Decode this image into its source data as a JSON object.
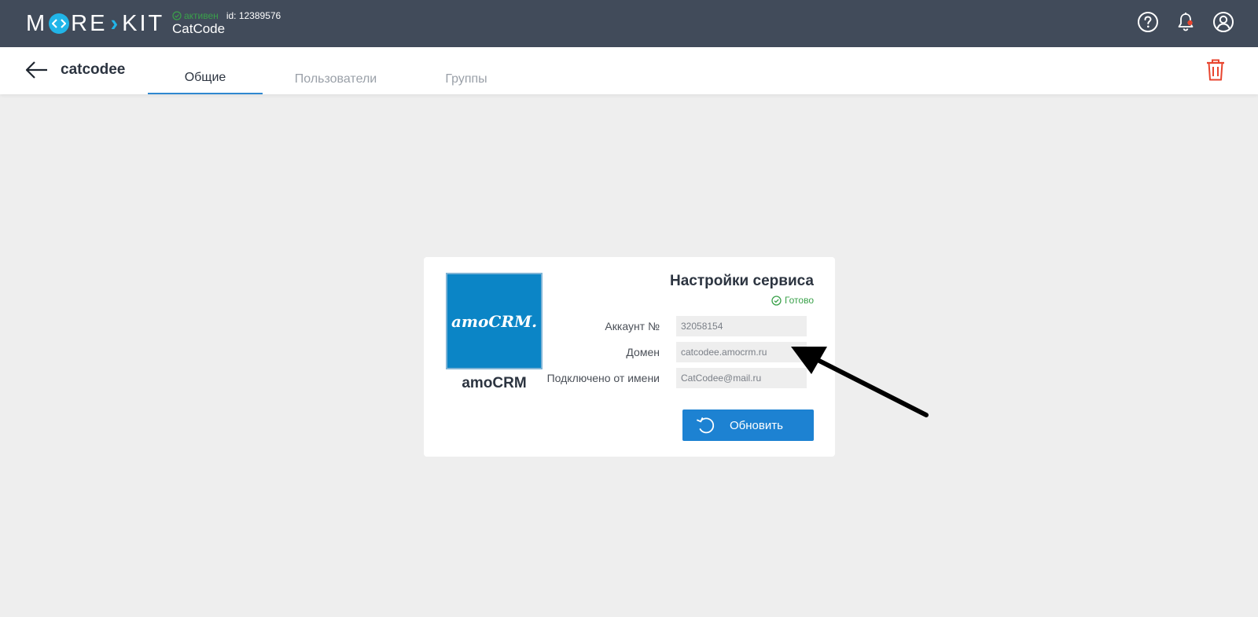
{
  "header": {
    "logo_text_left": "M",
    "logo_text_mid": "RE",
    "logo_text_right": "KIT",
    "logo_brand": "MOREKIT",
    "status_active": "активен",
    "account_id": "id: 12389576",
    "company_name": "CatCode",
    "icons": [
      "help-icon",
      "bell-icon",
      "user-profile-icon"
    ],
    "bell_notification_color": "#e8452f"
  },
  "subheader": {
    "title": "catcodee",
    "tabs": [
      {
        "label": "Общие",
        "active": true
      },
      {
        "label": "Пользователи",
        "active": false
      },
      {
        "label": "Группы",
        "active": false
      }
    ],
    "delete_icon_color": "#e8452f"
  },
  "service": {
    "logo_text": "amoCRM.",
    "name": "amoCRM",
    "settings_title": "Настройки сервиса",
    "status": "Готово",
    "fields": [
      {
        "label": "Аккаунт №",
        "value": "32058154"
      },
      {
        "label": "Домен",
        "value": "catcodee.amocrm.ru"
      },
      {
        "label": "Подключено от имени",
        "value": "CatCodee@mail.ru"
      }
    ],
    "refresh_label": "Обновить"
  },
  "colors": {
    "topbar": "#414b5a",
    "accent": "#1d82d2",
    "success": "#3aa14a",
    "danger": "#e8452f",
    "logo_bg": "#0b85c6"
  }
}
